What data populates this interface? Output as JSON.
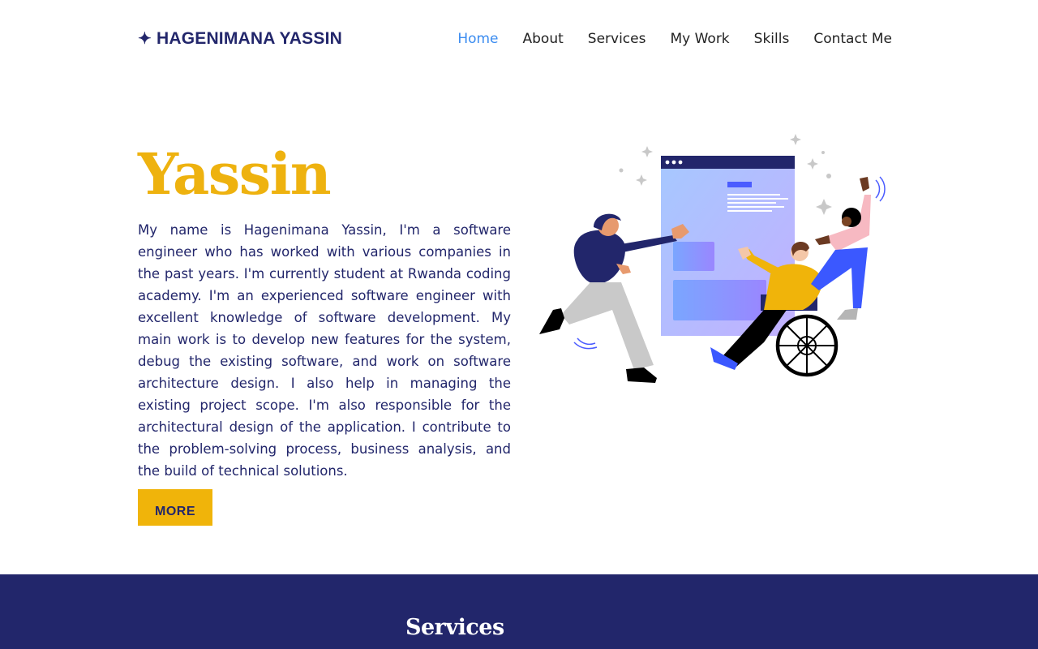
{
  "header": {
    "logo_icon": "sparkle-icon",
    "logo_text": "HAGENIMANA YASSIN",
    "nav": [
      {
        "label": "Home",
        "active": true
      },
      {
        "label": "About",
        "active": false
      },
      {
        "label": "Services",
        "active": false
      },
      {
        "label": "My Work",
        "active": false
      },
      {
        "label": "Skills",
        "active": false
      },
      {
        "label": "Contact Me",
        "active": false
      }
    ]
  },
  "hero": {
    "name": "Yassin",
    "bio": "My name is Hagenimana Yassin, I'm a software engineer who has worked with various companies in the past years. I'm currently student at Rwanda coding academy. I'm an experienced software engineer with excellent knowledge of software development. My main work is to develop new features for the system, debug the existing software, and work on software architecture design. I also help in managing the existing project scope. I'm also responsible for the architectural design of the application. I contribute to the problem-solving process, business analysis, and the build of technical solutions.",
    "button_label": "MORE"
  },
  "services": {
    "title": "Services"
  },
  "colors": {
    "navy": "#22266b",
    "accent_yellow": "#f0b40a",
    "active_link": "#3b8cf0"
  }
}
